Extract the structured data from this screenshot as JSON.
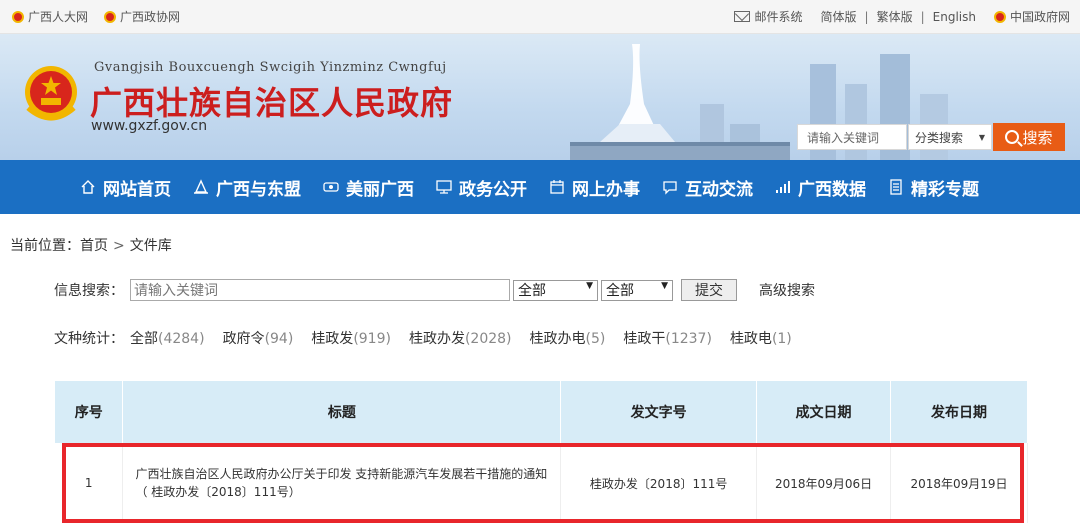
{
  "topbar": {
    "links_left": [
      "广西人大网",
      "广西政协网"
    ],
    "mail": "邮件系统",
    "lang": [
      "简体版",
      "繁体版",
      "English"
    ],
    "gov_link": "中国政府网"
  },
  "banner": {
    "pinyin": "Gvangjsih Bouxcuengh Swcigih Yinzminz Cwngfuj",
    "title": "广西壮族自治区人民政府",
    "url": "www.gxzf.gov.cn",
    "search_placeholder": "请输入关键词",
    "search_category": "分类搜索",
    "search_button": "搜索"
  },
  "nav": {
    "items": [
      "网站首页",
      "广西与东盟",
      "美丽广西",
      "政务公开",
      "网上办事",
      "互动交流",
      "广西数据",
      "精彩专题"
    ]
  },
  "breadcrumb": {
    "label": "当前位置：",
    "home": "首页",
    "arrow": ">",
    "current": "文件库"
  },
  "search": {
    "label": "信息搜索：",
    "placeholder": "请输入关键词",
    "select1": "全部",
    "select2": "全部",
    "submit": "提交",
    "advanced": "高级搜索"
  },
  "stats": {
    "label": "文种统计：",
    "items": [
      {
        "name": "全部",
        "count": "(4284)"
      },
      {
        "name": "政府令",
        "count": "(94)"
      },
      {
        "name": "桂政发",
        "count": "(919)"
      },
      {
        "name": "桂政办发",
        "count": "(2028)"
      },
      {
        "name": "桂政办电",
        "count": "(5)"
      },
      {
        "name": "桂政干",
        "count": "(1237)"
      },
      {
        "name": "桂政电",
        "count": "(1)"
      }
    ]
  },
  "table": {
    "headers": [
      "序号",
      "标题",
      "发文字号",
      "成文日期",
      "发布日期"
    ],
    "rows": [
      {
        "index": "1",
        "title": "广西壮族自治区人民政府办公厅关于印发 支持新能源汽车发展若干措施的通知（ 桂政办发〔2018〕111号）",
        "doc_no": "桂政办发〔2018〕111号",
        "written": "2018年09月06日",
        "published": "2018年09月19日"
      }
    ]
  },
  "colors": {
    "nav_bg": "#1b6fc3",
    "title_red": "#cc1e1e",
    "search_orange": "#e85c15",
    "header_bg": "#d7ecf7",
    "highlight": "#e8262b"
  }
}
